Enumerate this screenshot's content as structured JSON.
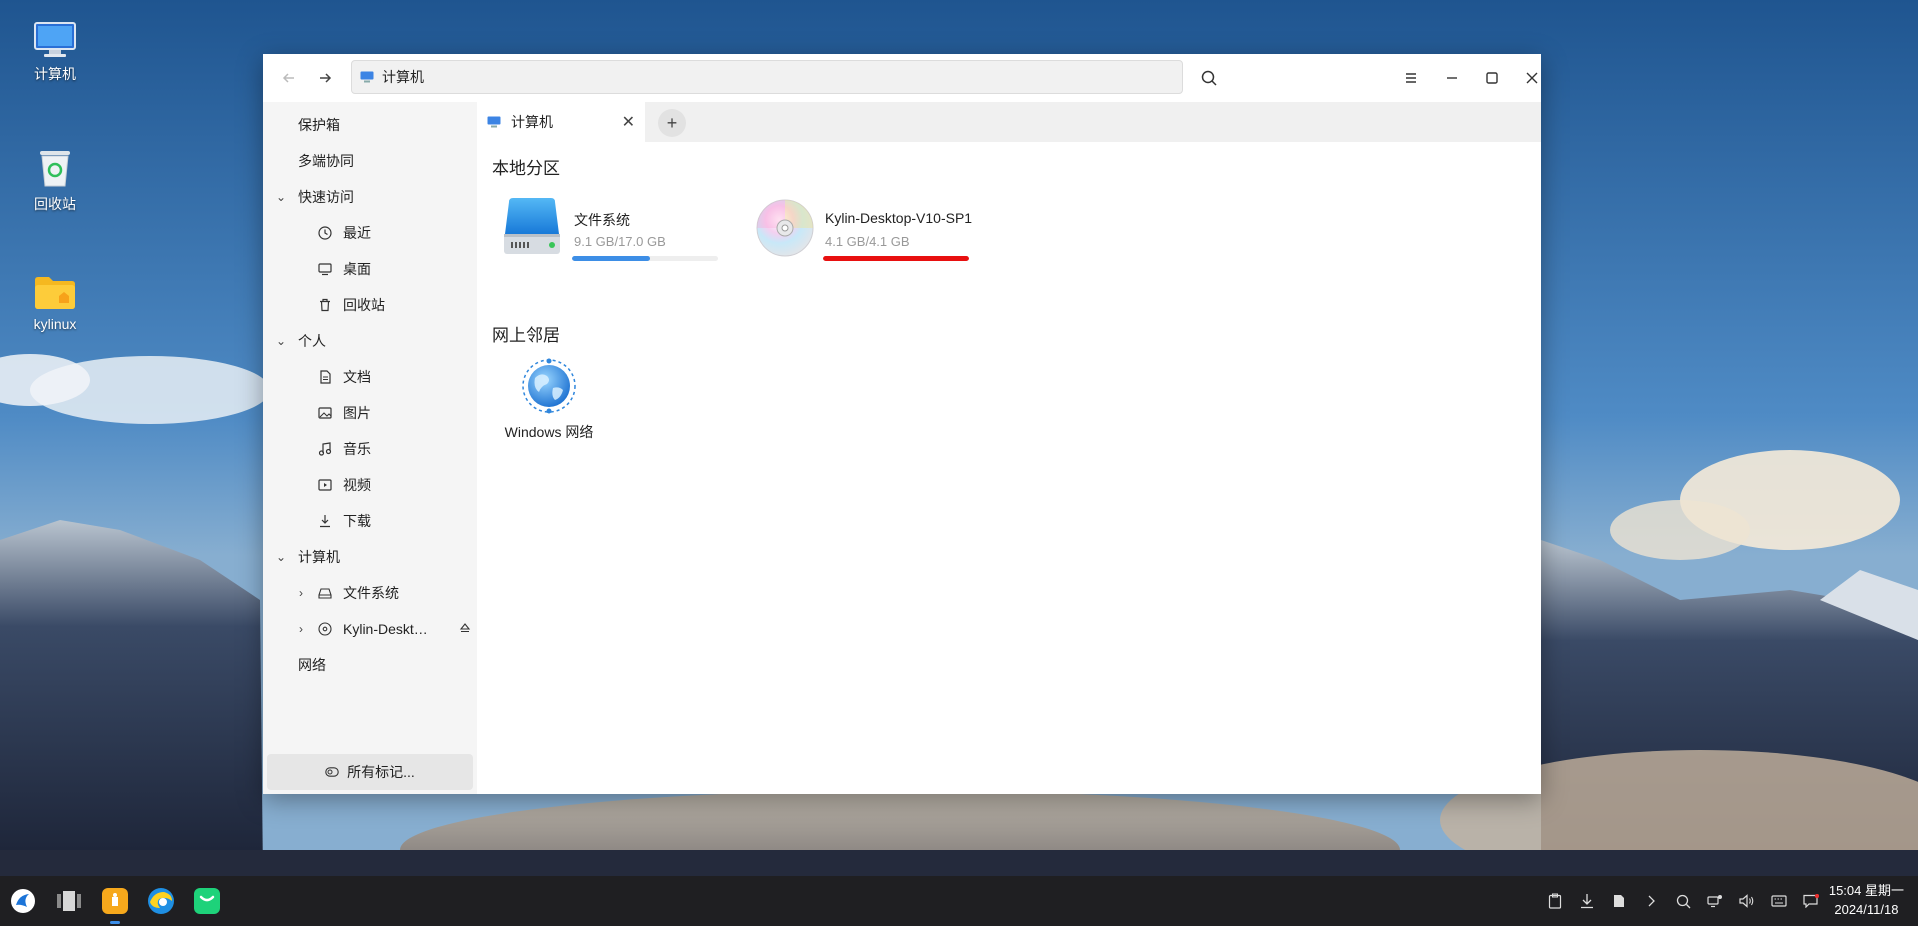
{
  "desktop": {
    "icons": [
      {
        "label": "计算机"
      },
      {
        "label": "回收站"
      },
      {
        "label": "kylinux"
      }
    ]
  },
  "window": {
    "address": "计算机",
    "sidebar": {
      "items": [
        {
          "label": "保护箱"
        },
        {
          "label": "多端协同"
        },
        {
          "label": "快速访问"
        },
        {
          "label": "最近"
        },
        {
          "label": "桌面"
        },
        {
          "label": "回收站"
        },
        {
          "label": "个人"
        },
        {
          "label": "文档"
        },
        {
          "label": "图片"
        },
        {
          "label": "音乐"
        },
        {
          "label": "视频"
        },
        {
          "label": "下载"
        },
        {
          "label": "计算机"
        },
        {
          "label": "文件系统"
        },
        {
          "label": "Kylin-Deskt…"
        },
        {
          "label": "网络"
        }
      ],
      "tags_button": "所有标记..."
    },
    "tab": {
      "label": "计算机"
    },
    "sections": {
      "local": "本地分区",
      "network": "网上邻居"
    },
    "drives": [
      {
        "name": "文件系统",
        "size": "9.1 GB/17.0 GB",
        "usage": 0.535,
        "color": "#3d8ee6"
      },
      {
        "name": "Kylin-Desktop-V10-SP1",
        "size": "4.1 GB/4.1 GB",
        "usage": 1.0,
        "color": "#e81010"
      }
    ],
    "network_items": [
      {
        "label": "Windows 网络"
      }
    ]
  },
  "taskbar": {
    "time": "15:04 星期一",
    "date": "2024/11/18"
  }
}
